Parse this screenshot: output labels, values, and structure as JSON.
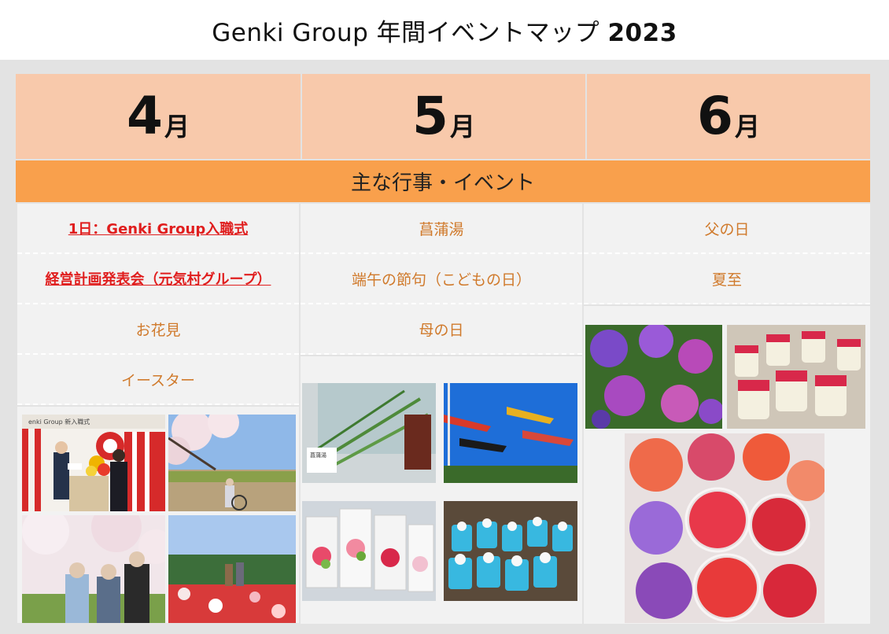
{
  "title": {
    "text": "Genki Group 年間イベントマップ ",
    "year": "2023"
  },
  "months": [
    {
      "num": "4",
      "unit": "月"
    },
    {
      "num": "5",
      "unit": "月"
    },
    {
      "num": "6",
      "unit": "月"
    }
  ],
  "band": "主な行事・イベント",
  "april_events": [
    "1日：Genki Group入職式",
    "経営計画発表会（元気村グループ）",
    "お花見",
    "イースター"
  ],
  "may_events": [
    "菖蒲湯",
    "端午の節句（こどもの日）",
    "母の日"
  ],
  "june_events": [
    "父の日",
    "夏至"
  ],
  "photo_texts": {
    "ceremony_sign": "enki Group 新入職式",
    "iris_sign": "菖蒲湯"
  },
  "colors": {
    "month_header": "#f8c9ab",
    "band": "#f9a04c",
    "event_text": "#d07a2c",
    "highlight_text": "#e01e1e",
    "cell": "#f2f2f2"
  }
}
